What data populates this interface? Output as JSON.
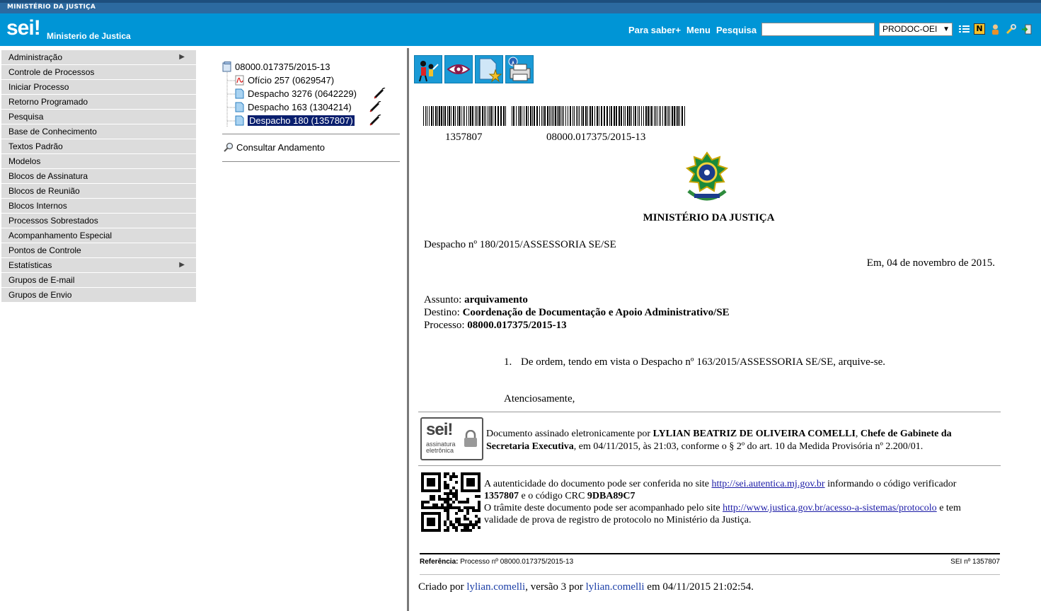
{
  "topbar": {
    "title": "MINISTÉRIO DA JUSTIÇA"
  },
  "header": {
    "logo": "sei!",
    "org_name": "Ministerio de Justica",
    "links": {
      "para_saber": "Para saber+",
      "menu": "Menu",
      "pesquisa": "Pesquisa"
    },
    "search": {
      "value": "",
      "placeholder": ""
    },
    "unit_select": {
      "selected": "PRODOC-OEI"
    },
    "icons": [
      "list-icon",
      "notes-icon",
      "user-icon",
      "tools-icon",
      "exit-icon"
    ]
  },
  "sidebar": {
    "items": [
      {
        "label": "Administração",
        "submenu": true
      },
      {
        "label": "Controle de Processos"
      },
      {
        "label": "Iniciar Processo"
      },
      {
        "label": "Retorno Programado"
      },
      {
        "label": "Pesquisa"
      },
      {
        "label": "Base de Conhecimento"
      },
      {
        "label": "Textos Padrão"
      },
      {
        "label": "Modelos"
      },
      {
        "label": "Blocos de Assinatura"
      },
      {
        "label": "Blocos de Reunião"
      },
      {
        "label": "Blocos Internos"
      },
      {
        "label": "Processos Sobrestados"
      },
      {
        "label": "Acompanhamento Especial"
      },
      {
        "label": "Pontos de Controle"
      },
      {
        "label": "Estatísticas",
        "submenu": true
      },
      {
        "label": "Grupos de E-mail"
      },
      {
        "label": "Grupos de Envio"
      }
    ]
  },
  "tree": {
    "process": "08000.017375/2015-13",
    "documents": [
      {
        "label": "Ofício 257 (0629547)",
        "type": "pdf"
      },
      {
        "label": "Despacho 3276 (0642229)",
        "type": "doc",
        "signed": true
      },
      {
        "label": "Despacho 163 (1304214)",
        "type": "doc",
        "signed": true
      },
      {
        "label": "Despacho 180 (1357807)",
        "type": "doc",
        "signed": true,
        "selected": true
      }
    ],
    "consultar": "Consultar Andamento"
  },
  "toolbar": {
    "icons": [
      "assign-users-icon",
      "view-eye-icon",
      "favorite-doc-icon",
      "print-icon"
    ]
  },
  "document": {
    "barcode_left": "1357807",
    "barcode_right": "08000.017375/2015-13",
    "ministry": "MINISTÉRIO DA JUSTIÇA",
    "doc_title": "Despacho nº 180/2015/ASSESSORIA SE/SE",
    "date": "Em, 04 de novembro de 2015.",
    "assunto_label": "Assunto:",
    "assunto": "arquivamento",
    "destino_label": "Destino:",
    "destino": "Coordenação de Documentação e Apoio Administrativo/SE",
    "processo_label": "Processo:",
    "processo": "08000.017375/2015-13",
    "item_num": "1.",
    "item_text": "De ordem, tendo em vista o Despacho nº 163/2015/ASSESSORIA SE/SE, arquive-se.",
    "closing": "Atenciosamente,",
    "sig_stamp_logo": "sei!",
    "sig_stamp_caption": "assinatura eletrônica",
    "sig_text_1": "Documento assinado eletronicamente por",
    "sig_name": "LYLIAN BEATRIZ DE OLIVEIRA COMELLI",
    "sig_sep": ", ",
    "sig_role_1": "Chefe de Gabinete da",
    "sig_role_2": "Secretaria Executiva",
    "sig_text_2": ", em 04/11/2015, às 21:03, conforme o § 2º do art. 10 da Medida Provisória nº 2.200/01.",
    "auth_1": "A autenticidade do documento pode ser conferida no site",
    "auth_link": "http://sei.autentica.mj.gov.br",
    "auth_2": "informando o código verificador",
    "auth_code": "1357807",
    "auth_3": "e o código CRC",
    "auth_crc": "9DBA89C7",
    "track_1": "O trâmite deste documento pode ser acompanhado pelo site",
    "track_link": "http://www.justica.gov.br/acesso-a-sistemas/protocolo",
    "track_2": "e tem",
    "track_3": "validade de prova de registro de protocolo no Ministério da Justiça.",
    "ref_label": "Referência:",
    "ref_text": "Processo nº 08000.017375/2015-13",
    "ref_right": "SEI nº 1357807",
    "footer_1": "Criado por",
    "footer_user1": "lylian.comelli",
    "footer_2": ", versão 3 por",
    "footer_user2": "lylian.comelli",
    "footer_3": "em 04/11/2015 21:02:54."
  },
  "colors": {
    "header": "#0095d6",
    "topbar": "#2c6aa0",
    "menu_bg": "#dcdcdc",
    "selected": "#0a1f6e"
  }
}
